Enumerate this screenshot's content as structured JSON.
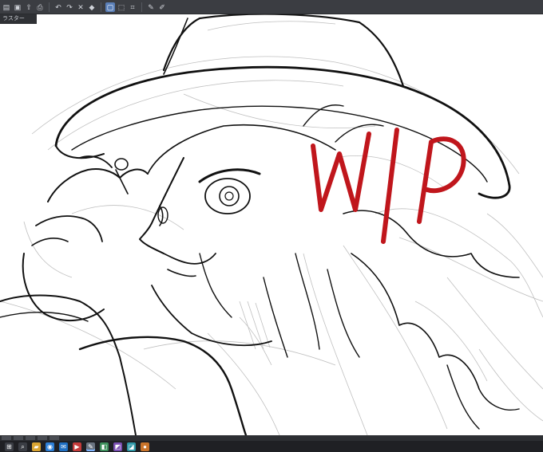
{
  "app": {
    "subpanel_label": "ラスター"
  },
  "toolbar": {
    "buttons": [
      {
        "icon": "file-icon",
        "glyph": "▤"
      },
      {
        "icon": "save-icon",
        "glyph": "▣"
      },
      {
        "icon": "export-icon",
        "glyph": "⇧"
      },
      {
        "icon": "print-icon",
        "glyph": "⎙"
      },
      {
        "icon": "undo-icon",
        "glyph": "↶"
      },
      {
        "icon": "redo-icon",
        "glyph": "↷"
      },
      {
        "icon": "clear-icon",
        "glyph": "✕"
      },
      {
        "icon": "fill-icon",
        "glyph": "◆"
      },
      {
        "icon": "transform-icon",
        "glyph": "▢"
      },
      {
        "icon": "select-icon",
        "glyph": "⬚"
      },
      {
        "icon": "ruler-icon",
        "glyph": "⌗"
      },
      {
        "icon": "pen-icon",
        "glyph": "✎"
      },
      {
        "icon": "brush-icon",
        "glyph": "✐"
      }
    ],
    "active_index": 8
  },
  "canvas": {
    "annotation_text": "W/P",
    "annotation_color": "#c0161c",
    "lineart_color": "#111111",
    "sketch_color": "#b9b9b9"
  },
  "statusbar": {
    "items": [
      "",
      "",
      "",
      "",
      ""
    ]
  },
  "taskbar": {
    "icons": [
      {
        "name": "start-icon",
        "glyph": "⊞",
        "color": "#3a3d44"
      },
      {
        "name": "search-icon",
        "glyph": "⌕",
        "color": "#3a3d44"
      },
      {
        "name": "explorer-icon",
        "glyph": "▰",
        "color": "#d9a430"
      },
      {
        "name": "browser-icon",
        "glyph": "◉",
        "color": "#2d7fd6"
      },
      {
        "name": "mail-icon",
        "glyph": "✉",
        "color": "#1f6fc2"
      },
      {
        "name": "media-icon",
        "glyph": "▶",
        "color": "#c43b3b"
      },
      {
        "name": "clip-studio-icon",
        "glyph": "✎",
        "color": "#6a7380"
      },
      {
        "name": "app-icon-1",
        "glyph": "◧",
        "color": "#3c8f5b"
      },
      {
        "name": "app-icon-2",
        "glyph": "◩",
        "color": "#7b4fb3"
      },
      {
        "name": "app-icon-3",
        "glyph": "◪",
        "color": "#2e97a6"
      },
      {
        "name": "app-icon-4",
        "glyph": "●",
        "color": "#c9742a"
      }
    ]
  }
}
